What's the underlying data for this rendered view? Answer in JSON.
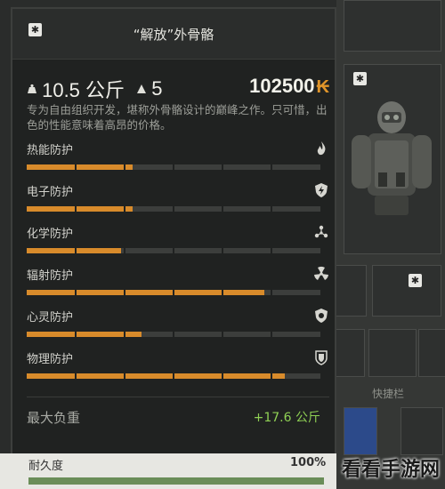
{
  "item": {
    "title": "“解放”外骨骼",
    "weight": "10.5 公斤",
    "slots": "5",
    "price": "102500",
    "currency_symbol": "₭",
    "description": "专为自由组织开发，堪称外骨骼设计的巅峰之作。只可惜，出色的性能意味着高昂的价格。"
  },
  "stats": [
    {
      "label": "热能防护",
      "icon": "flame-icon",
      "value": 0.36
    },
    {
      "label": "电子防护",
      "icon": "electric-shield-icon",
      "value": 0.36
    },
    {
      "label": "化学防护",
      "icon": "chemical-icon",
      "value": 0.32
    },
    {
      "label": "辐射防护",
      "icon": "radiation-icon",
      "value": 0.81
    },
    {
      "label": "心灵防护",
      "icon": "psi-shield-icon",
      "value": 0.39
    },
    {
      "label": "物理防护",
      "icon": "physical-shield-icon",
      "value": 0.88
    }
  ],
  "max_load": {
    "label": "最大负重",
    "value": "+17.6 公斤"
  },
  "durability": {
    "label": "耐久度",
    "value": "100%",
    "fraction": 1.0
  },
  "side": {
    "quickbar_label": "快捷栏"
  },
  "watermark": "看看手游网",
  "colors": {
    "accent": "#d88b2b",
    "positive": "#8fd054",
    "durability": "#6a8d58"
  }
}
